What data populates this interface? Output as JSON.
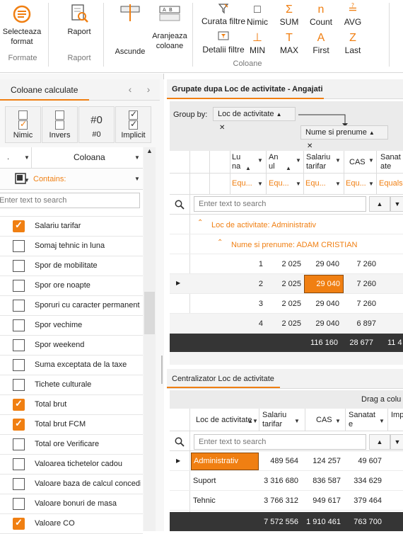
{
  "ribbon": {
    "format_group": {
      "select_label": "Selecteaza\nformat",
      "group_label": "Formate"
    },
    "report_group": {
      "report_label": "Raport",
      "group_label": "Raport"
    },
    "columns_group": {
      "asc_label": "Ascunde",
      "arrange_label": "Aranjeaza\ncoloane",
      "clear_filters_label": "Curata filtre",
      "filter_details_label": "Detalii filtre",
      "group_label": "Coloane"
    },
    "aggregates": [
      {
        "label": "Nimic",
        "icon": "none-icon",
        "glyph": "□"
      },
      {
        "label": "SUM",
        "icon": "sum-icon",
        "glyph": "Σ"
      },
      {
        "label": "Count",
        "icon": "count-icon",
        "glyph": "n"
      },
      {
        "label": "AVG",
        "icon": "avg-icon",
        "glyph": "≟"
      },
      {
        "label": "MIN",
        "icon": "min-icon",
        "glyph": "⊥"
      },
      {
        "label": "MAX",
        "icon": "max-icon",
        "glyph": "T"
      },
      {
        "label": "First",
        "icon": "first-icon",
        "glyph": "A"
      },
      {
        "label": "Last",
        "icon": "last-icon",
        "glyph": "Z"
      }
    ]
  },
  "left": {
    "title": "Coloane calculate",
    "options": [
      {
        "label": "Nimic",
        "top": "",
        "state": "on"
      },
      {
        "label": "Invers",
        "top": "",
        "state": "off"
      },
      {
        "label": "#0",
        "top": "#0",
        "state": "num"
      },
      {
        "label": "Implicit",
        "top": "",
        "state": "both"
      }
    ],
    "column_header": "Coloana",
    "filter_text": "Contains:",
    "search_placeholder": "Enter text to search",
    "rows": [
      {
        "label": "Salariu tarifar",
        "checked": true
      },
      {
        "label": "Somaj tehnic in luna",
        "checked": false
      },
      {
        "label": "Spor de mobilitate",
        "checked": false
      },
      {
        "label": "Spor ore noapte",
        "checked": false
      },
      {
        "label": "Sporuri cu caracter permanent",
        "checked": false
      },
      {
        "label": "Spor vechime",
        "checked": false
      },
      {
        "label": "Spor weekend",
        "checked": false
      },
      {
        "label": "Suma exceptata de la taxe",
        "checked": false
      },
      {
        "label": "Tichete culturale",
        "checked": false
      },
      {
        "label": "Total brut",
        "checked": true
      },
      {
        "label": "Total brut FCM",
        "checked": true
      },
      {
        "label": "Total ore Verificare",
        "checked": false
      },
      {
        "label": "Valoarea tichetelor cadou",
        "checked": false
      },
      {
        "label": "Valoare baza de calcul concedii",
        "checked": false
      },
      {
        "label": "Valoare bonuri de masa",
        "checked": false
      },
      {
        "label": "Valoare CO",
        "checked": true
      }
    ]
  },
  "top_grid": {
    "title": "Grupate dupa Loc de activitate - Angajati",
    "group_by_label": "Group by:",
    "chips": [
      "Loc de activitate",
      "Nume si prenume"
    ],
    "headers": [
      "Luna",
      "Anul",
      "Salariu tarifar",
      "CAS",
      "Sanatate"
    ],
    "filter_label": "Equ...",
    "filter_label_last": "Equals",
    "search_placeholder": "Enter text to search",
    "group1": "Loc de activitate: Administrativ",
    "group2": "Nume si prenume: ADAM CRISTIAN",
    "rows": [
      {
        "luna": "1",
        "anul": "2 025",
        "salariu": "29 040",
        "cas": "7 260"
      },
      {
        "luna": "2",
        "anul": "2 025",
        "salariu": "29 040",
        "cas": "7 260"
      },
      {
        "luna": "3",
        "anul": "2 025",
        "salariu": "29 040",
        "cas": "7 260"
      },
      {
        "luna": "4",
        "anul": "2 025",
        "salariu": "29 040",
        "cas": "6 897"
      }
    ],
    "totals": {
      "salariu": "116 160",
      "cas": "28 677",
      "sanatate": "11 4"
    }
  },
  "bottom_grid": {
    "title": "Centralizator Loc de activitate",
    "drag_hint": "Drag a colu",
    "headers": [
      "Loc de activitate",
      "Salariu tarifar",
      "CAS",
      "Sanatate",
      "Imp"
    ],
    "search_placeholder": "Enter text to search",
    "rows": [
      {
        "loc": "Administrativ",
        "salariu": "489 564",
        "cas": "124 257",
        "sanatate": "49 607"
      },
      {
        "loc": "Suport",
        "salariu": "3 316 680",
        "cas": "836 587",
        "sanatate": "334 629"
      },
      {
        "loc": "Tehnic",
        "salariu": "3 766 312",
        "cas": "949 617",
        "sanatate": "379 464"
      }
    ],
    "totals": {
      "salariu": "7 572 556",
      "cas": "1 910 461",
      "sanatate": "763 700"
    }
  },
  "colors": {
    "accent": "#f07f12",
    "footer": "#353535"
  }
}
